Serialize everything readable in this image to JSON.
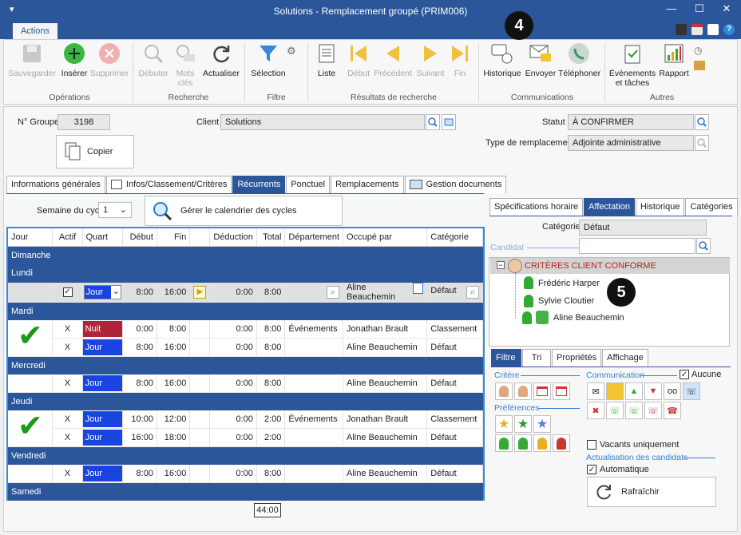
{
  "window": {
    "title": "Solutions - Remplacement groupé (PRIM006)"
  },
  "ribbon": {
    "tab": "Actions",
    "groups": {
      "operations": "Opérations",
      "recherche": "Recherche",
      "filtre": "Filtre",
      "resultats": "Résultats de recherche",
      "communications": "Communications",
      "autres": "Autres"
    },
    "buttons": {
      "sauvegarder": "Sauvegarder",
      "inserer": "Insérer",
      "supprimer": "Supprimer",
      "debuter": "Débuter",
      "mots_cles_1": "Mots",
      "mots_cles_2": "clés",
      "actualiser": "Actualiser",
      "selection": "Sélection",
      "liste": "Liste",
      "debut": "Début",
      "precedent": "Précédent",
      "suivant": "Suivant",
      "fin": "Fin",
      "historique": "Historique",
      "envoyer": "Envoyer",
      "telephoner": "Téléphoner",
      "evenements_1": "Évènements",
      "evenements_2": "et tâches",
      "rapport": "Rapport"
    }
  },
  "header": {
    "groupe_label": "N° Groupe",
    "groupe_value": "3198",
    "client_label": "Client",
    "client_value": "Solutions",
    "statut_label": "Statut",
    "statut_value": "À CONFIRMER",
    "type_label": "Type de remplacement",
    "type_value": "Adjointe administrative",
    "copier": "Copier"
  },
  "badges": {
    "b4": "4",
    "b5": "5"
  },
  "main_tabs": [
    "Informations générales",
    "Infos/Classement/Critères",
    "Récurrents",
    "Ponctuel",
    "Remplacements",
    "Gestion documents"
  ],
  "cycle": {
    "label": "Semaine du cycle",
    "value": "1",
    "calendar_button": "Gérer le calendrier des cycles"
  },
  "grid": {
    "headers": [
      "Jour",
      "Actif",
      "Quart",
      "Début",
      "Fin",
      "Déduction",
      "Total",
      "Département",
      "Occupé par",
      "Catégorie"
    ],
    "days": {
      "dimanche": "Dimanche",
      "lundi": "Lundi",
      "mardi": "Mardi",
      "mercredi": "Mercredi",
      "jeudi": "Jeudi",
      "vendredi": "Vendredi",
      "samedi": "Samedi"
    },
    "lundi_row": {
      "quart": "Jour",
      "debut": "8:00",
      "fin": "16:00",
      "deduction": "0:00",
      "total": "8:00",
      "occupe": "Aline Beauchemin",
      "categorie": "Défaut"
    },
    "mardi_rows": [
      {
        "actif": "X",
        "quart": "Nuit",
        "debut": "0:00",
        "fin": "8:00",
        "deduction": "0:00",
        "total": "8:00",
        "departement": "Événements",
        "occupe": "Jonathan Brault",
        "categorie": "Classement"
      },
      {
        "actif": "X",
        "quart": "Jour",
        "debut": "8:00",
        "fin": "16:00",
        "deduction": "0:00",
        "total": "8:00",
        "departement": "",
        "occupe": "Aline Beauchemin",
        "categorie": "Défaut"
      }
    ],
    "mercredi_row": {
      "actif": "X",
      "quart": "Jour",
      "debut": "8:00",
      "fin": "16:00",
      "deduction": "0:00",
      "total": "8:00",
      "occupe": "Aline Beauchemin",
      "categorie": "Défaut"
    },
    "jeudi_rows": [
      {
        "actif": "X",
        "quart": "Jour",
        "debut": "10:00",
        "fin": "12:00",
        "deduction": "0:00",
        "total": "2:00",
        "departement": "Événements",
        "occupe": "Jonathan Brault",
        "categorie": "Classement"
      },
      {
        "actif": "X",
        "quart": "Jour",
        "debut": "16:00",
        "fin": "18:00",
        "deduction": "0:00",
        "total": "2:00",
        "departement": "",
        "occupe": "Aline Beauchemin",
        "categorie": "Défaut"
      }
    ],
    "vendredi_row": {
      "actif": "X",
      "quart": "Jour",
      "debut": "8:00",
      "fin": "16:00",
      "deduction": "0:00",
      "total": "8:00",
      "occupe": "Aline Beauchemin",
      "categorie": "Défaut"
    },
    "total": "44:00"
  },
  "right": {
    "tabs": [
      "Spécifications horaire",
      "Affectation",
      "Historique",
      "Catégories"
    ],
    "categorie_label": "Catégorie",
    "categorie_value": "Défaut",
    "candidat_label": "Candidat",
    "tree": {
      "root": "CRITÈRES CLIENT CONFORME",
      "children": [
        "Frédéric Harper",
        "Sylvie Cloutier",
        "Aline Beauchemin"
      ]
    },
    "filter_tabs": [
      "Filtre",
      "Tri",
      "Propriétés",
      "Affichage"
    ],
    "critere": "Critère",
    "communication": "Communication",
    "aucune": "Aucune",
    "preferences": "Préférences",
    "vacants": "Vacants uniquement",
    "actualisation": "Actualisation des candidats",
    "automatique": "Automatique",
    "rafraichir": "Rafraîchir"
  }
}
